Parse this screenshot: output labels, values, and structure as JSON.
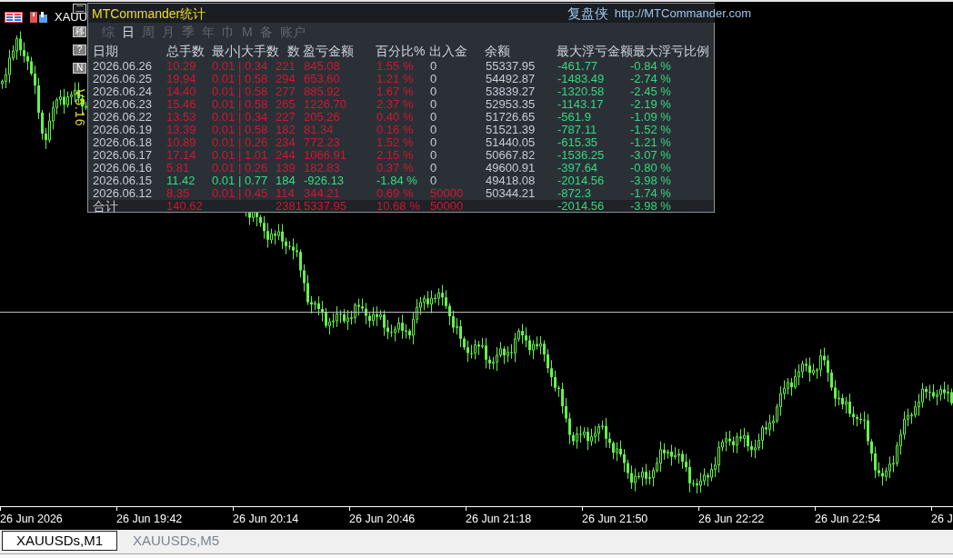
{
  "chart": {
    "title": "XAUU",
    "time_axis": [
      "26 Jun 2026",
      "26 Jun 19:42",
      "26 Jun 20:14",
      "26 Jun 20:46",
      "26 Jun 21:18",
      "26 Jun 21:50",
      "26 Jun 22:22",
      "26 Jun 22:54",
      "26 J"
    ]
  },
  "panel": {
    "side_buttons": [
      {
        "label": "二",
        "kind": "plain"
      },
      {
        "label": "移",
        "kind": "filled"
      },
      {
        "label": "?",
        "kind": "filled"
      },
      {
        "label": "N",
        "kind": "filled"
      }
    ],
    "version": "V5.16",
    "title": "MTCommander统计",
    "brand": "复盘侠",
    "url": "http://MTCommander.com",
    "tabs": [
      {
        "label": "综",
        "selected": false
      },
      {
        "label": "日",
        "selected": true
      },
      {
        "label": "周",
        "selected": false
      },
      {
        "label": "月",
        "selected": false
      },
      {
        "label": "季",
        "selected": false
      },
      {
        "label": "年",
        "selected": false
      },
      {
        "label": "巾",
        "selected": false
      },
      {
        "label": "M",
        "selected": false
      },
      {
        "label": "备",
        "selected": false
      },
      {
        "label": "账户",
        "selected": false
      }
    ],
    "table": {
      "columns": [
        "日期",
        "总手数",
        "最小|大手数",
        "数",
        "盈亏金额",
        "百分比%",
        "出入金",
        "余额",
        "最大浮亏金额",
        "最大浮亏比例"
      ],
      "rows": [
        {
          "date": "2026.06.26",
          "total_lots": "10.29",
          "min_max_lots": "0.01 | 0.34",
          "count": "221",
          "pnl": "845.08",
          "percent": "1.55 %",
          "in_out": "0",
          "balance": "55337.95",
          "max_float_loss": "-461.77",
          "max_float_loss_ratio": "-0.84 %",
          "profit": true,
          "deposit": false
        },
        {
          "date": "2026.06.25",
          "total_lots": "19.94",
          "min_max_lots": "0.01 | 0.58",
          "count": "294",
          "pnl": "653.60",
          "percent": "1.21 %",
          "in_out": "0",
          "balance": "54492.87",
          "max_float_loss": "-1483.49",
          "max_float_loss_ratio": "-2.74 %",
          "profit": true,
          "deposit": false
        },
        {
          "date": "2026.06.24",
          "total_lots": "14.40",
          "min_max_lots": "0.01 | 0.58",
          "count": "277",
          "pnl": "885.92",
          "percent": "1.67 %",
          "in_out": "0",
          "balance": "53839.27",
          "max_float_loss": "-1320.58",
          "max_float_loss_ratio": "-2.45 %",
          "profit": true,
          "deposit": false
        },
        {
          "date": "2026.06.23",
          "total_lots": "15.46",
          "min_max_lots": "0.01 | 0.58",
          "count": "265",
          "pnl": "1226.70",
          "percent": "2.37 %",
          "in_out": "0",
          "balance": "52953.35",
          "max_float_loss": "-1143.17",
          "max_float_loss_ratio": "-2.19 %",
          "profit": true,
          "deposit": false
        },
        {
          "date": "2026.06.22",
          "total_lots": "13.53",
          "min_max_lots": "0.01 | 0.34",
          "count": "227",
          "pnl": "205.26",
          "percent": "0.40 %",
          "in_out": "0",
          "balance": "51726.65",
          "max_float_loss": "-561.9",
          "max_float_loss_ratio": "-1.09 %",
          "profit": true,
          "deposit": false
        },
        {
          "date": "2026.06.19",
          "total_lots": "13.39",
          "min_max_lots": "0.01 | 0.58",
          "count": "182",
          "pnl": "81.34",
          "percent": "0.16 %",
          "in_out": "0",
          "balance": "51521.39",
          "max_float_loss": "-787.11",
          "max_float_loss_ratio": "-1.52 %",
          "profit": true,
          "deposit": false
        },
        {
          "date": "2026.06.18",
          "total_lots": "10.89",
          "min_max_lots": "0.01 | 0.26",
          "count": "234",
          "pnl": "772.23",
          "percent": "1.52 %",
          "in_out": "0",
          "balance": "51440.05",
          "max_float_loss": "-615.35",
          "max_float_loss_ratio": "-1.21 %",
          "profit": true,
          "deposit": false
        },
        {
          "date": "2026.06.17",
          "total_lots": "17.14",
          "min_max_lots": "0.01 | 1.01",
          "count": "244",
          "pnl": "1066.91",
          "percent": "2.15 %",
          "in_out": "0",
          "balance": "50667.82",
          "max_float_loss": "-1536.25",
          "max_float_loss_ratio": "-3.07 %",
          "profit": true,
          "deposit": false
        },
        {
          "date": "2026.06.16",
          "total_lots": "5.81",
          "min_max_lots": "0.01 | 0.26",
          "count": "139",
          "pnl": "182.83",
          "percent": "0.37 %",
          "in_out": "0",
          "balance": "49600.91",
          "max_float_loss": "-397.64",
          "max_float_loss_ratio": "-0.80 %",
          "profit": true,
          "deposit": false
        },
        {
          "date": "2026.06.15",
          "total_lots": "11.42",
          "min_max_lots": "0.01 | 0.77",
          "count": "184",
          "pnl": "-926.13",
          "percent": "-1.84 %",
          "in_out": "0",
          "balance": "49418.08",
          "max_float_loss": "-2014.56",
          "max_float_loss_ratio": "-3.98 %",
          "profit": false,
          "deposit": false
        },
        {
          "date": "2026.06.12",
          "total_lots": "8.35",
          "min_max_lots": "0.01 | 0.45",
          "count": "114",
          "pnl": "344.21",
          "percent": "0.69 %",
          "in_out": "50000",
          "balance": "50344.21",
          "max_float_loss": "-872.3",
          "max_float_loss_ratio": "-1.74 %",
          "profit": true,
          "deposit": true
        }
      ],
      "total": {
        "label": "合计",
        "total_lots": "140.62",
        "count": "2381",
        "pnl": "5337.95",
        "percent": "10.68 %",
        "in_out": "50000",
        "max_float_loss": "-2014.56",
        "max_float_loss_ratio": "-3.98 %",
        "profit": true,
        "deposit": true
      }
    }
  },
  "chart_tabs": [
    {
      "label": "XAUUSDs,M1",
      "selected": true
    },
    {
      "label": "XAUUSDs,M5",
      "selected": false
    }
  ]
}
